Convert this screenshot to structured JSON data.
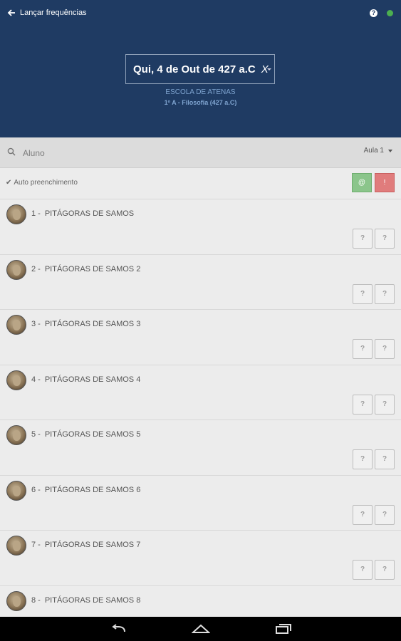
{
  "header": {
    "back_label": "Lançar frequências",
    "help_icon": "?"
  },
  "date_selector": {
    "value": "Qui, 4 de Out de 427 a.C",
    "clear": "X"
  },
  "school": "ESCOLA DE ATENAS",
  "class_info": "1º A - Filosofia (427 a.C)",
  "search": {
    "placeholder": "Aluno",
    "aula": "Aula 1"
  },
  "auto_fill": {
    "label": "Auto preenchimento",
    "present_btn": "@",
    "absent_btn": "!"
  },
  "students": [
    {
      "num": "1 -",
      "name": "PITÁGORAS DE SAMOS"
    },
    {
      "num": "2 -",
      "name": "PITÁGORAS DE SAMOS 2"
    },
    {
      "num": "3 -",
      "name": "PITÁGORAS DE SAMOS 3"
    },
    {
      "num": "4 -",
      "name": "PITÁGORAS DE SAMOS 4"
    },
    {
      "num": "5 -",
      "name": "PITÁGORAS DE SAMOS 5"
    },
    {
      "num": "6 -",
      "name": "PITÁGORAS DE SAMOS 6"
    },
    {
      "num": "7 -",
      "name": "PITÁGORAS DE SAMOS 7"
    },
    {
      "num": "8 -",
      "name": "PITÁGORAS DE SAMOS 8"
    }
  ],
  "attendance_btn": "?",
  "colors": {
    "header_bg": "#1f3b63",
    "status_dot": "#4caf50",
    "present": "#8bc58b",
    "absent": "#e07c7c"
  }
}
